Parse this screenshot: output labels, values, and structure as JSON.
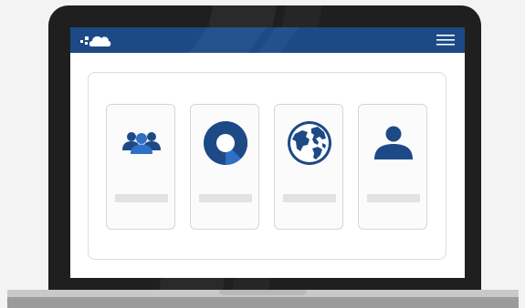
{
  "app": {
    "logo_icon": "cloud-icon",
    "menu_icon": "hamburger-menu-icon"
  },
  "colors": {
    "topbar": "#1d4a86",
    "icon_primary": "#1d4a86",
    "icon_secondary": "#2f6fc4",
    "laptop_bezel": "#1f1f1f",
    "card_bg": "#fbfbfb",
    "placeholder_bar": "#e2e2e2"
  },
  "cards": [
    {
      "icon": "users-group-icon",
      "label": ""
    },
    {
      "icon": "donut-chart-icon",
      "label": ""
    },
    {
      "icon": "globe-icon",
      "label": ""
    },
    {
      "icon": "user-icon",
      "label": ""
    }
  ]
}
